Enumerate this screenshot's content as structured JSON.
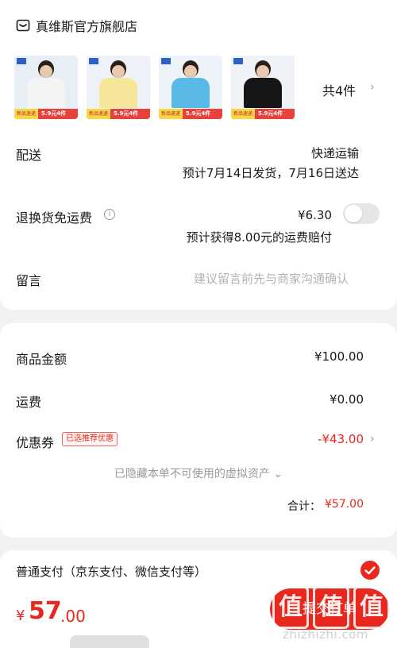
{
  "store": {
    "name": "真维斯官方旗舰店",
    "icon": "store-icon"
  },
  "products": {
    "thumbnails": [
      {
        "shirt_color": "#f4f4f4",
        "bg": "#e8eef6",
        "tag_left": "新品速递",
        "tag_right": "5.9元4件"
      },
      {
        "shirt_color": "#f6e69a",
        "bg": "#eef2f8",
        "tag_left": "新品速递",
        "tag_right": "5.9元4件"
      },
      {
        "shirt_color": "#5ab8e6",
        "bg": "#eef3fa",
        "tag_left": "新品速递",
        "tag_right": "5.9元4件"
      },
      {
        "shirt_color": "#161616",
        "bg": "#eff2f7",
        "tag_left": "新品速递",
        "tag_right": "5.9元4件"
      }
    ],
    "count_label": "共4件"
  },
  "delivery": {
    "label": "配送",
    "method": "快递运输",
    "estimate": "预计7月14日发货，7月16日送达"
  },
  "return_insurance": {
    "label": "退换货免运费",
    "price": "¥6.30",
    "note": "预计获得8.00元的运费赔付",
    "enabled": false
  },
  "message": {
    "label": "留言",
    "placeholder": "建议留言前先与商家沟通确认"
  },
  "summary": {
    "goods_label": "商品金额",
    "goods_value": "¥100.00",
    "shipping_label": "运费",
    "shipping_value": "¥0.00",
    "coupon_label": "优惠券",
    "coupon_badge": "已选推荐优惠",
    "coupon_value": "-¥43.00",
    "hidden_note": "已隐藏本单不可使用的虚拟资产 ⌄",
    "total_label": "合计：",
    "total_value": "¥57.00"
  },
  "payment": {
    "method_label": "普通支付（京东支付、微信支付等）",
    "selected": true
  },
  "bottom": {
    "price_symbol": "¥",
    "price_integer": "57",
    "price_decimal": ".00",
    "submit_label": "提交订单"
  },
  "watermark": {
    "chars": [
      "值",
      "值",
      "值"
    ],
    "url": "zhizhizhi.com"
  },
  "colors": {
    "accent": "#e8281e",
    "background": "#f2f2f2"
  }
}
